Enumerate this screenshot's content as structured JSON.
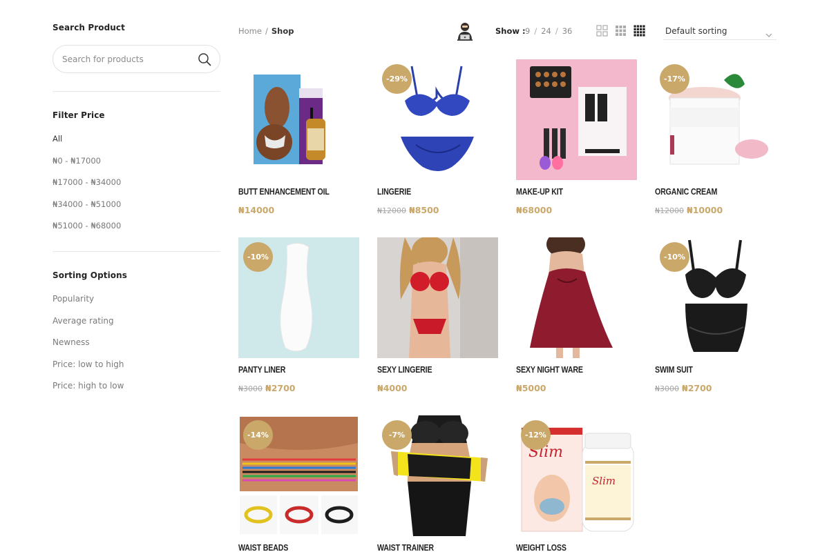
{
  "sidebar": {
    "search_title": "Search Product",
    "search_placeholder": "Search for products",
    "filter_title": "Filter Price",
    "filter_options": [
      "All",
      "₦0 - ₦17000",
      "₦17000 - ₦34000",
      "₦34000 - ₦51000",
      "₦51000 - ₦68000"
    ],
    "sort_title": "Sorting Options",
    "sort_options": [
      "Popularity",
      "Average rating",
      "Newness",
      "Price: low to high",
      "Price: high to low"
    ]
  },
  "toolbar": {
    "breadcrumb_home": "Home",
    "breadcrumb_sep": "/",
    "breadcrumb_current": "Shop",
    "show_label": "Show :",
    "show_options": [
      "9",
      "24",
      "36"
    ],
    "show_sep": "/",
    "sorting_value": "Default sorting"
  },
  "accent_color": "#c9a86a",
  "products": [
    {
      "name": "BUTT ENHANCEMENT OIL",
      "old_price": "",
      "price": "₦14000",
      "badge": ""
    },
    {
      "name": "LINGERIE",
      "old_price": "₦12000",
      "price": "₦8500",
      "badge": "-29%"
    },
    {
      "name": "MAKE-UP KIT",
      "old_price": "",
      "price": "₦68000",
      "badge": ""
    },
    {
      "name": "ORGANIC CREAM",
      "old_price": "₦12000",
      "price": "₦10000",
      "badge": "-17%"
    },
    {
      "name": "PANTY LINER",
      "old_price": "₦3000",
      "price": "₦2700",
      "badge": "-10%"
    },
    {
      "name": "SEXY LINGERIE",
      "old_price": "",
      "price": "₦4000",
      "badge": ""
    },
    {
      "name": "SEXY NIGHT WARE",
      "old_price": "",
      "price": "₦5000",
      "badge": ""
    },
    {
      "name": "SWIM SUIT",
      "old_price": "₦3000",
      "price": "₦2700",
      "badge": "-10%"
    },
    {
      "name": "WAIST BEADS",
      "old_price": "",
      "price": "",
      "badge": "-14%"
    },
    {
      "name": "WAIST TRAINER",
      "old_price": "",
      "price": "",
      "badge": "-7%"
    },
    {
      "name": "WEIGHT LOSS",
      "old_price": "",
      "price": "",
      "badge": "-12%"
    }
  ]
}
